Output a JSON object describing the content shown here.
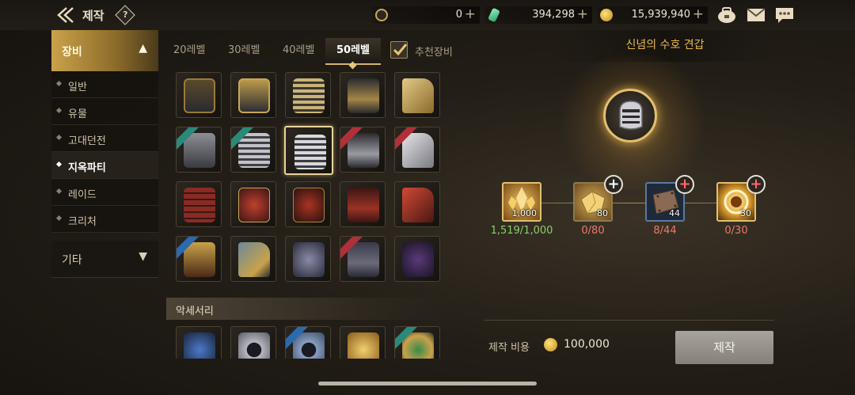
{
  "header": {
    "title": "제작",
    "help": "?",
    "currencies": [
      {
        "icon": "crystal-coin-icon",
        "value": "0"
      },
      {
        "icon": "gem-icon",
        "value": "394,298"
      },
      {
        "icon": "gold-coin-icon",
        "value": "15,939,940"
      }
    ],
    "icons": [
      "bag-icon",
      "mail-icon",
      "chat-icon"
    ]
  },
  "sidebar": {
    "category_equip": "장비",
    "items": [
      "일반",
      "유물",
      "고대던전",
      "지옥파티",
      "레이드",
      "크리처"
    ],
    "active_index": 3,
    "category_etc": "기타"
  },
  "tabs": {
    "levels": [
      "20레벨",
      "30레벨",
      "40레벨",
      "50레벨"
    ],
    "active_index": 3,
    "recommend_label": "추천장비",
    "recommend_checked": true
  },
  "grid": {
    "accessory_section": "악세서리"
  },
  "detail": {
    "item_name": "신념의 수호 견갑",
    "materials": [
      {
        "qty": "1,000",
        "count": "1,519/1,000",
        "enough": true,
        "plus": false
      },
      {
        "qty": "80",
        "count": "0/80",
        "enough": false,
        "plus": true
      },
      {
        "qty": "44",
        "count": "8/44",
        "enough": false,
        "plus": true
      },
      {
        "qty": "30",
        "count": "0/30",
        "enough": false,
        "plus": true
      }
    ],
    "cost_label": "제작 비용",
    "cost_value": "100,000",
    "craft_button": "제작"
  },
  "colors": {
    "accent_gold": "#e8b94a",
    "count_ok": "#8bcf6a",
    "count_bad": "#e97b6c"
  }
}
